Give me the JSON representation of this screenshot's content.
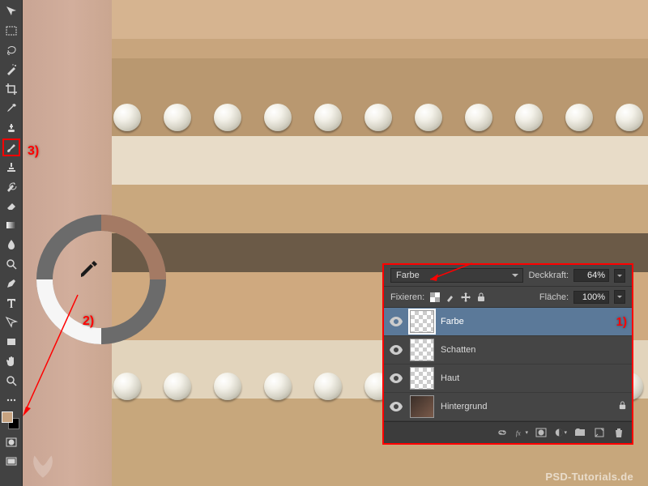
{
  "annotations": {
    "label1": "1)",
    "label2": "2)",
    "label3": "3)"
  },
  "toolbar": {
    "tools": [
      {
        "name": "move-tool"
      },
      {
        "name": "rectangular-marquee-tool"
      },
      {
        "name": "lasso-tool"
      },
      {
        "name": "magic-wand-tool"
      },
      {
        "name": "crop-tool"
      },
      {
        "name": "eyedropper-tool"
      },
      {
        "name": "spot-healing-brush-tool"
      },
      {
        "name": "brush-tool",
        "selected": true
      },
      {
        "name": "clone-stamp-tool"
      },
      {
        "name": "history-brush-tool"
      },
      {
        "name": "eraser-tool"
      },
      {
        "name": "gradient-tool"
      },
      {
        "name": "blur-tool"
      },
      {
        "name": "dodge-tool"
      },
      {
        "name": "pen-tool"
      },
      {
        "name": "type-tool"
      },
      {
        "name": "path-selection-tool"
      },
      {
        "name": "rectangle-tool"
      },
      {
        "name": "hand-tool"
      },
      {
        "name": "zoom-tool"
      }
    ],
    "foreground_color": "#c7a380",
    "background_color": "#000000"
  },
  "layers_panel": {
    "blend_mode_label": "Farbe",
    "opacity_label": "Deckkraft:",
    "opacity_value": "64%",
    "lock_label": "Fixieren:",
    "fill_label": "Fläche:",
    "fill_value": "100%",
    "layers": [
      {
        "name": "Farbe",
        "visible": true,
        "selected": true,
        "thumb": "transparent"
      },
      {
        "name": "Schatten",
        "visible": true,
        "selected": false,
        "thumb": "transparent"
      },
      {
        "name": "Haut",
        "visible": true,
        "selected": false,
        "thumb": "transparent"
      },
      {
        "name": "Hintergrund",
        "visible": true,
        "selected": false,
        "thumb": "image"
      }
    ],
    "footer_icons": [
      "link-layers-icon",
      "layer-style-icon",
      "layer-mask-icon",
      "adjustment-layer-icon",
      "layer-group-icon",
      "new-layer-icon",
      "delete-layer-icon"
    ]
  },
  "watermark": "PSD-Tutorials.de"
}
